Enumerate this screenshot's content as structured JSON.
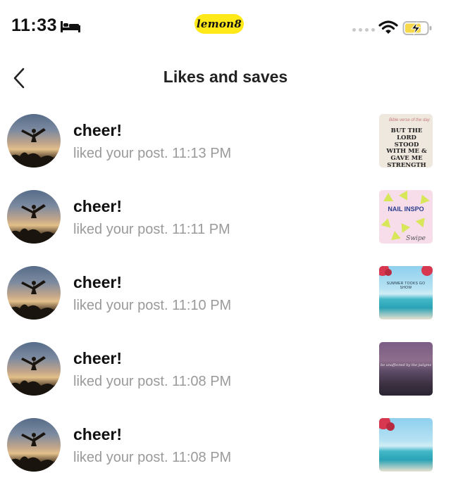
{
  "status_bar": {
    "time": "11:33",
    "app_badge": "lemon8",
    "icons": [
      "bed-icon",
      "signal-dots-icon",
      "wifi-icon",
      "battery-charging-icon"
    ]
  },
  "header": {
    "title": "Likes and saves",
    "back_icon": "chevron-left-icon"
  },
  "notifications": [
    {
      "name": "cheer!",
      "action": "liked your post.",
      "time": "11:13 PM",
      "thumb_text": [
        "Bible verse of the day",
        "BUT THE LORD STOOD WITH ME & GAVE ME STRENGTH"
      ]
    },
    {
      "name": "cheer!",
      "action": "liked your post.",
      "time": "11:11 PM",
      "thumb_text": [
        "NAIL INSPO",
        "Swipe"
      ]
    },
    {
      "name": "cheer!",
      "action": "liked your post.",
      "time": "11:10 PM",
      "thumb_text": [
        "SUMMER TOOKS GO SHOW"
      ]
    },
    {
      "name": "cheer!",
      "action": "liked your post.",
      "time": "11:08 PM",
      "thumb_text": [
        "be unaffected by the judgment of others"
      ]
    },
    {
      "name": "cheer!",
      "action": "liked your post.",
      "time": "11:08 PM",
      "thumb_text": []
    }
  ],
  "colors": {
    "badge_yellow": "#ffe919",
    "secondary_text": "#9a9a9a",
    "battery_fill": "#f6d84a"
  }
}
